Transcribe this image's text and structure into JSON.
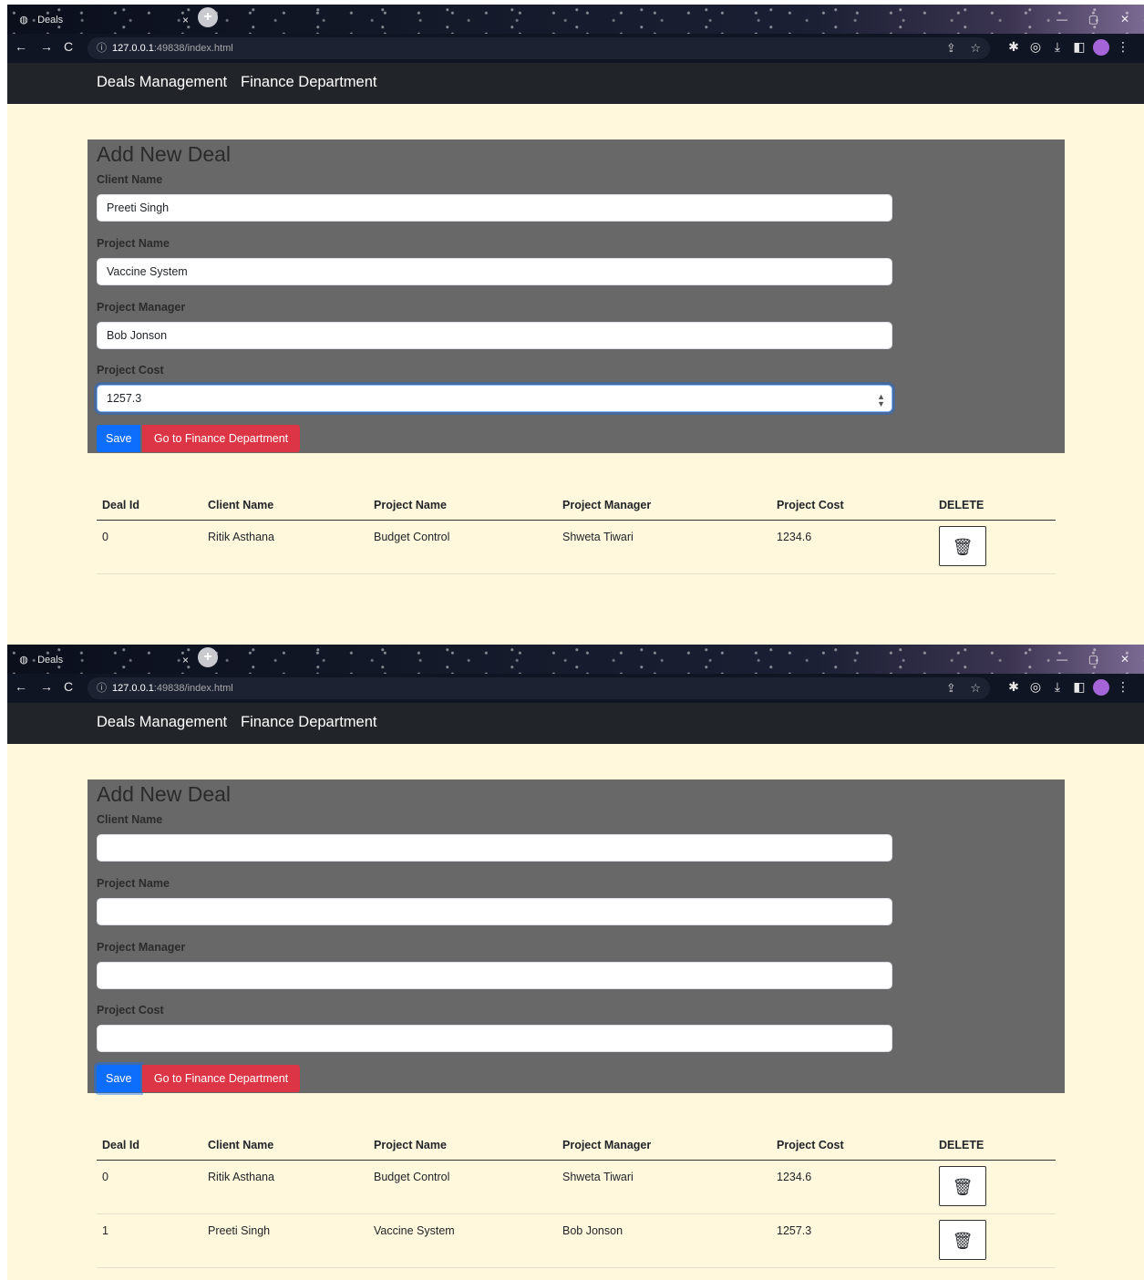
{
  "browser": {
    "tab_title": "Deals",
    "tab_close": "×",
    "new_tab": "+",
    "url_host": "127.0.0.1",
    "url_path": ":49838/index.html"
  },
  "navbar": {
    "brand": "Deals Management",
    "finance_link": "Finance Department"
  },
  "form": {
    "heading": "Add New Deal",
    "client_label": "Client Name",
    "project_label": "Project Name",
    "manager_label": "Project Manager",
    "cost_label": "Project Cost",
    "save_label": "Save",
    "finance_button_label": "Go to Finance Department"
  },
  "screens": [
    {
      "values": {
        "client": "Preeti Singh",
        "project": "Vaccine System",
        "manager": "Bob Jonson",
        "cost": "1257.3"
      },
      "rows": [
        {
          "id": "0",
          "client": "Ritik Asthana",
          "project": "Budget Control",
          "manager": "Shweta Tiwari",
          "cost": "1234.6"
        }
      ]
    },
    {
      "values": {
        "client": "",
        "project": "",
        "manager": "",
        "cost": ""
      },
      "rows": [
        {
          "id": "0",
          "client": "Ritik Asthana",
          "project": "Budget Control",
          "manager": "Shweta Tiwari",
          "cost": "1234.6"
        },
        {
          "id": "1",
          "client": "Preeti Singh",
          "project": "Vaccine System",
          "manager": "Bob Jonson",
          "cost": "1257.3"
        }
      ]
    }
  ],
  "table": {
    "headers": [
      "Deal Id",
      "Client Name",
      "Project Name",
      "Project Manager",
      "Project Cost",
      "DELETE"
    ]
  },
  "icons": {
    "trash": "🗑",
    "info": "ⓘ",
    "back": "←",
    "forward": "→",
    "reload": "C",
    "share": "⇪",
    "star": "☆",
    "minimize": "—",
    "restore": "▢",
    "close": "✕"
  }
}
